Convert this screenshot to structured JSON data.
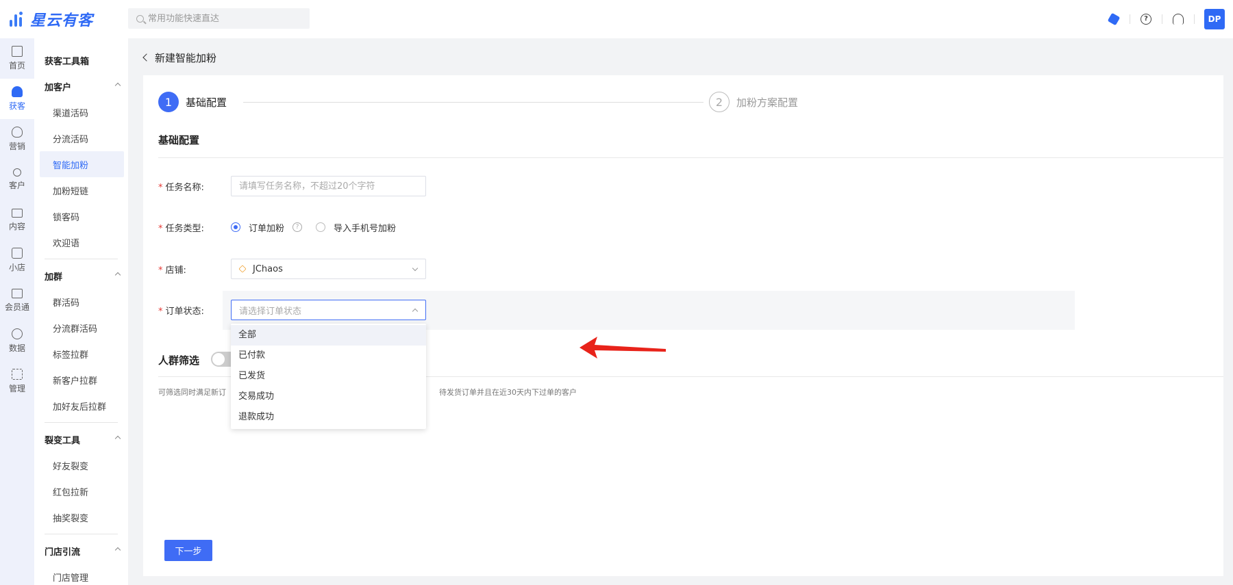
{
  "app": {
    "brand": "星云有客",
    "user_initials": "DP"
  },
  "search": {
    "placeholder": "常用功能快速直达"
  },
  "rail": [
    {
      "label": "首页",
      "icon": "home-icon"
    },
    {
      "label": "获客",
      "icon": "user-add-icon",
      "active": true
    },
    {
      "label": "营销",
      "icon": "bulb-icon"
    },
    {
      "label": "客户",
      "icon": "person-icon"
    },
    {
      "label": "内容",
      "icon": "folder-icon"
    },
    {
      "label": "小店",
      "icon": "shop-icon"
    },
    {
      "label": "会员通",
      "icon": "member-icon"
    },
    {
      "label": "数据",
      "icon": "pie-chart-icon"
    },
    {
      "label": "管理",
      "icon": "grid-icon"
    }
  ],
  "subnav": {
    "title": "获客工具箱",
    "groups": [
      {
        "title": "加客户",
        "items": [
          "渠道活码",
          "分流活码",
          "智能加粉",
          "加粉短链",
          "锁客码",
          "欢迎语"
        ]
      },
      {
        "title": "加群",
        "items": [
          "群活码",
          "分流群活码",
          "标签拉群",
          "新客户拉群",
          "加好友后拉群"
        ]
      },
      {
        "title": "裂变工具",
        "items": [
          "好友裂变",
          "红包拉新",
          "抽奖裂变"
        ]
      },
      {
        "title": "门店引流",
        "items": [
          "门店管理"
        ]
      }
    ],
    "active_item": "智能加粉"
  },
  "page": {
    "title": "新建智能加粉"
  },
  "steps": [
    {
      "num": "1",
      "label": "基础配置",
      "active": true
    },
    {
      "num": "2",
      "label": "加粉方案配置",
      "active": false
    }
  ],
  "form": {
    "section_title": "基础配置",
    "task_name": {
      "label": "任务名称:",
      "placeholder": "请填写任务名称，不超过20个字符",
      "value": ""
    },
    "task_type": {
      "label": "任务类型:",
      "options": [
        "订单加粉",
        "导入手机号加粉"
      ],
      "selected": "订单加粉"
    },
    "shop": {
      "label": "店铺:",
      "value": "JChaos"
    },
    "order_status": {
      "label": "订单状态:",
      "placeholder": "请选择订单状态",
      "options": [
        "全部",
        "已付款",
        "已发货",
        "交易成功",
        "退款成功"
      ],
      "hovered": "全部"
    }
  },
  "crowd": {
    "title": "人群筛选",
    "enabled": false,
    "desc_left": "可筛选同时满足新订",
    "desc_right": "待发货订单并且在近30天内下过单的客户"
  },
  "actions": {
    "next": "下一步"
  },
  "colors": {
    "accent": "#3f6cf5",
    "arrow": "#e8231a"
  }
}
